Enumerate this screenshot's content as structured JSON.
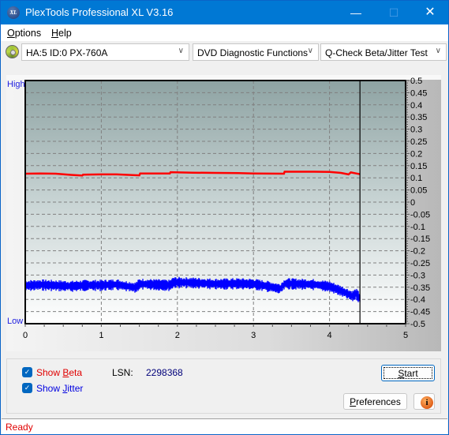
{
  "window": {
    "title": "PlexTools Professional XL V3.16",
    "logo_text": "XL",
    "controls": {
      "minimize": "—",
      "maximize": "☐",
      "close": "✕"
    }
  },
  "menu": {
    "items": [
      {
        "label": "Options",
        "accel": "O",
        "rest": "ptions"
      },
      {
        "label": "Help",
        "accel": "H",
        "rest": "elp"
      }
    ]
  },
  "toolbar": {
    "drive": {
      "value": "HA:5 ID:0  PX-760A",
      "icon": "disc-icon"
    },
    "function": {
      "value": "DVD Diagnostic Functions"
    },
    "test": {
      "value": "Q-Check Beta/Jitter Test"
    },
    "dropdown_glyph": "∨"
  },
  "chart": {
    "high_label": "High",
    "low_label": "Low",
    "colors": {
      "beta": "#ff0000",
      "jitter": "#0000ff",
      "marker": "#000000"
    }
  },
  "chart_data": {
    "type": "line",
    "title": "",
    "xlabel": "",
    "ylabel": "",
    "xlim": [
      0,
      5
    ],
    "ylim": [
      -0.5,
      0.5
    ],
    "x_ticks": [
      0,
      1,
      2,
      3,
      4,
      5
    ],
    "y_ticks": [
      0.5,
      0.45,
      0.4,
      0.35,
      0.3,
      0.25,
      0.2,
      0.15,
      0.1,
      0.05,
      0,
      -0.05,
      -0.1,
      -0.15,
      -0.2,
      -0.25,
      -0.3,
      -0.35,
      -0.4,
      -0.45,
      -0.5
    ],
    "y_tick_labels": [
      "0.5",
      "0.45",
      "0.4",
      "0.35",
      "0.3",
      "0.25",
      "0.2",
      "0.15",
      "0.1",
      "0.05",
      "0",
      "-0.05",
      "-0.1",
      "-0.15",
      "-0.2",
      "-0.25",
      "-0.3",
      "-0.35",
      "-0.4",
      "-0.45",
      "-0.5"
    ],
    "grid": true,
    "end_marker_x": 4.4,
    "series": [
      {
        "name": "Beta",
        "color": "#ff0000",
        "x": [
          0,
          0.2,
          0.4,
          0.6,
          0.75,
          0.76,
          1.0,
          1.2,
          1.5,
          1.51,
          1.9,
          1.91,
          2.2,
          2.5,
          2.8,
          3.0,
          3.4,
          3.41,
          3.8,
          4.0,
          4.15,
          4.25,
          4.28,
          4.35,
          4.4
        ],
        "values": [
          0.117,
          0.118,
          0.117,
          0.112,
          0.109,
          0.113,
          0.114,
          0.114,
          0.11,
          0.118,
          0.118,
          0.123,
          0.121,
          0.12,
          0.119,
          0.118,
          0.117,
          0.125,
          0.125,
          0.124,
          0.12,
          0.114,
          0.122,
          0.118,
          0.115
        ]
      },
      {
        "name": "Jitter",
        "color": "#0000ff",
        "x": [
          0,
          0.2,
          0.4,
          0.6,
          0.8,
          1.0,
          1.2,
          1.45,
          1.5,
          1.7,
          1.9,
          1.95,
          2.2,
          2.5,
          2.8,
          3.0,
          3.2,
          3.35,
          3.42,
          3.6,
          3.8,
          4.0,
          4.1,
          4.2,
          4.3,
          4.35,
          4.4
        ],
        "values": [
          -0.342,
          -0.338,
          -0.341,
          -0.344,
          -0.34,
          -0.34,
          -0.337,
          -0.35,
          -0.335,
          -0.337,
          -0.34,
          -0.328,
          -0.33,
          -0.335,
          -0.333,
          -0.335,
          -0.345,
          -0.355,
          -0.333,
          -0.335,
          -0.337,
          -0.345,
          -0.357,
          -0.37,
          -0.385,
          -0.375,
          -0.395
        ]
      }
    ]
  },
  "controls": {
    "show_beta": {
      "label": "Show Beta",
      "prefix": "Show ",
      "accel": "B",
      "rest": "eta",
      "checked": true,
      "color": "#e00000"
    },
    "show_jitter": {
      "label": "Show Jitter",
      "prefix": "Show ",
      "accel": "J",
      "rest": "itter",
      "checked": true,
      "color": "#0000e0"
    },
    "lsn_label": "LSN:",
    "lsn_value": "2298368",
    "start_button": {
      "label": "Start",
      "accel": "S",
      "rest": "tart"
    },
    "preferences_button": {
      "label": "Preferences",
      "accel": "P",
      "rest": "references"
    },
    "info_button": {
      "icon": "info-icon",
      "glyph": "i"
    },
    "checkmark": "✓"
  },
  "status": {
    "text": "Ready"
  }
}
